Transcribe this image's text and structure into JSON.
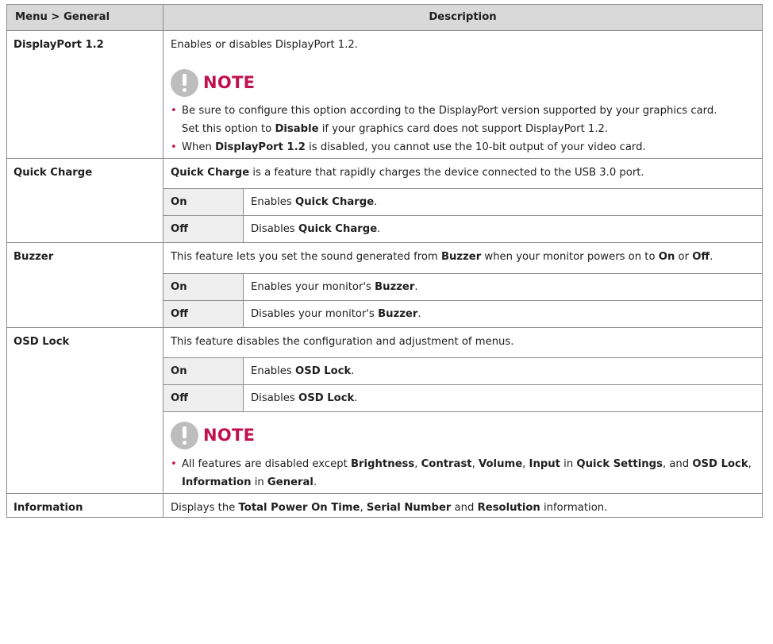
{
  "header": {
    "menu": "Menu > General",
    "description": "Description"
  },
  "displayport": {
    "name": "DisplayPort 1.2",
    "desc": "Enables or disables DisplayPort 1.2.",
    "note_title": "NOTE",
    "b1": "Be sure to configure this option according to the DisplayPort version supported by your graphics card.",
    "b1_sub_pre": "Set this option to ",
    "b1_sub_bold": "Disable",
    "b1_sub_post": " if your graphics card does not support DisplayPort 1.2.",
    "b2_pre": "When ",
    "b2_bold": "DisplayPort 1.2",
    "b2_post": " is disabled, you cannot use the 10-bit output of your video card."
  },
  "quickcharge": {
    "name": "Quick Charge",
    "desc_bold": "Quick Charge",
    "desc_post": " is a feature that rapidly charges the device connected to the USB 3.0 port.",
    "on_label": "On",
    "on_pre": "Enables ",
    "on_bold": "Quick Charge",
    "on_post": ".",
    "off_label": "Off",
    "off_pre": "Disables ",
    "off_bold": "Quick Charge",
    "off_post": "."
  },
  "buzzer": {
    "name": "Buzzer",
    "desc_pre": "This feature lets you set the sound generated from ",
    "desc_b1": "Buzzer",
    "desc_mid1": " when your monitor powers on to ",
    "desc_b2": "On",
    "desc_mid2": " or ",
    "desc_b3": "Off",
    "desc_post": ".",
    "on_label": "On",
    "on_pre": "Enables your monitor's ",
    "on_bold": "Buzzer",
    "on_post": ".",
    "off_label": "Off",
    "off_pre": "Disables your monitor's ",
    "off_bold": "Buzzer",
    "off_post": "."
  },
  "osdlock": {
    "name": "OSD Lock",
    "desc": "This feature disables the configuration and adjustment of menus.",
    "on_label": "On",
    "on_pre": "Enables ",
    "on_bold": "OSD Lock",
    "on_post": ".",
    "off_label": "Off",
    "off_pre": "Disables ",
    "off_bold": "OSD Lock",
    "off_post": ".",
    "note_title": "NOTE",
    "n_pre": "All features are disabled except ",
    "n_b1": "Brightness",
    "n_c1": ", ",
    "n_b2": "Contrast",
    "n_c2": ", ",
    "n_b3": "Volume",
    "n_c3": ", ",
    "n_b4": "Input",
    "n_in1": " in ",
    "n_b5": "Quick Settings",
    "n_and": ", and ",
    "n_b6": "OSD Lock",
    "n_c4": ", ",
    "n_b7": "Information",
    "n_in2": " in ",
    "n_b8": "General",
    "n_end": "."
  },
  "information": {
    "name": "Information",
    "pre": "Displays the ",
    "b1": "Total Power On Time",
    "c1": ", ",
    "b2": "Serial Number",
    "and": " and ",
    "b3": "Resolution",
    "post": " information."
  },
  "colors": {
    "accent": "#c1124c",
    "header_bg": "#d9d9d9",
    "sub_bg": "#efefef",
    "icon_gray": "#bdbdbd"
  }
}
